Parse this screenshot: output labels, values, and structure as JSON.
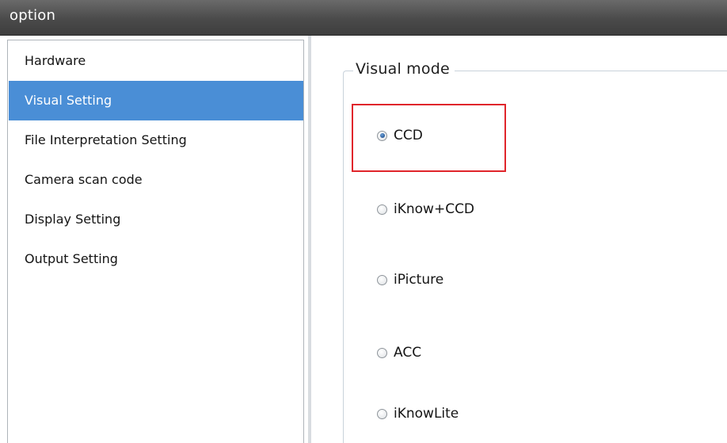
{
  "window": {
    "title": "option"
  },
  "sidebar": {
    "items": [
      {
        "label": "Hardware",
        "selected": false
      },
      {
        "label": "Visual Setting",
        "selected": true
      },
      {
        "label": "File Interpretation Setting",
        "selected": false
      },
      {
        "label": "Camera scan code",
        "selected": false
      },
      {
        "label": "Display Setting",
        "selected": false
      },
      {
        "label": "Output Setting",
        "selected": false
      }
    ]
  },
  "visual_mode": {
    "legend": "Visual mode",
    "options": [
      {
        "label": "CCD",
        "checked": true
      },
      {
        "label": "iKnow+CCD",
        "checked": false
      },
      {
        "label": "iPicture",
        "checked": false
      },
      {
        "label": "ACC",
        "checked": false
      },
      {
        "label": "iKnowLite",
        "checked": false
      }
    ]
  },
  "colors": {
    "selection": "#4a8ed6",
    "highlight_border": "#e0252b",
    "titlebar": "#4a4a4a"
  }
}
